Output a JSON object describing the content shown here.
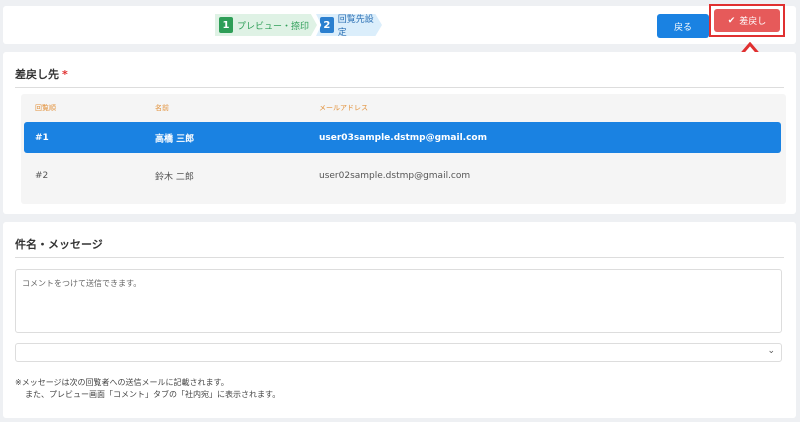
{
  "steps": [
    {
      "num": "1",
      "label": "プレビュー・捺印"
    },
    {
      "num": "2",
      "label": "回覧先設定"
    }
  ],
  "toolbar": {
    "back_label": "戻る",
    "return_label": "差戻し"
  },
  "return_section": {
    "title": "差戻し先",
    "required_mark": "*",
    "columns": [
      "回覧順",
      "名前",
      "メールアドレス"
    ],
    "rows": [
      {
        "order": "#1",
        "name": "高橋 三郎",
        "email": "user03sample.dstmp@gmail.com",
        "selected": true
      },
      {
        "order": "#2",
        "name": "鈴木 二郎",
        "email": "user02sample.dstmp@gmail.com",
        "selected": false
      }
    ]
  },
  "message_section": {
    "title": "件名・メッセージ",
    "comment_placeholder": "コメントをつけて送信できます。",
    "select_value": "",
    "note_line1": "※メッセージは次の回覧者への送信メールに記載されます。",
    "note_line2": "また、プレビュー画面「コメント」タブの「社内宛」に表示されます。"
  },
  "colors": {
    "primary": "#1a82e2",
    "danger": "#e65a5a",
    "highlight_border": "#e03030",
    "column_header": "#e2913a"
  }
}
